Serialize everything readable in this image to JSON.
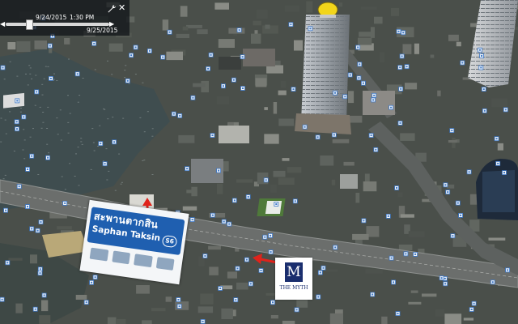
{
  "time_slider": {
    "start_date": "9/24/2015",
    "start_time": "1:30 PM",
    "end_date": "9/25/2015",
    "slider_position": 0.22,
    "icons": [
      "wrench-icon",
      "close-icon",
      "chevron-left-icon",
      "chevron-right-icon"
    ]
  },
  "overlays": {
    "station_sign": {
      "thai": "สะพานตากสิน",
      "latin": "Saphan Taksin",
      "code": "S6"
    },
    "hotel_logo": {
      "letter": "M",
      "name": "THE MYTH"
    }
  },
  "colors": {
    "river": "#3f4d4f",
    "arrow": "#e0231b",
    "station_blue": "#1f5fb0",
    "hotel_navy": "#1a2e6e",
    "tower_dome": "#f2d51a"
  }
}
